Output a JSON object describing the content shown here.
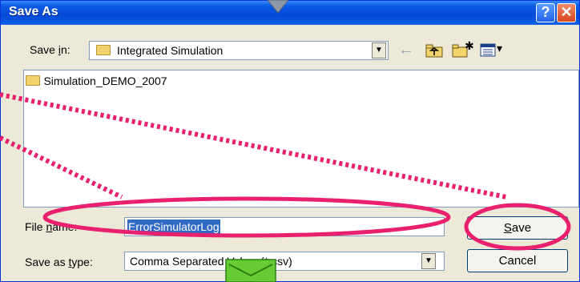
{
  "dialog": {
    "title": "Save As",
    "help_glyph": "?",
    "close_glyph": "✕"
  },
  "save_in": {
    "label_pre": "Save ",
    "label_u": "i",
    "label_post": "n:",
    "value": "Integrated Simulation"
  },
  "toolbar": {
    "back_glyph": "←",
    "new_folder_glyph": "✱",
    "view_caret": "▾"
  },
  "files": [
    {
      "name": "Simulation_DEMO_2007",
      "icon": "folder-icon"
    }
  ],
  "file_name": {
    "label_pre": "File ",
    "label_u": "n",
    "label_post": "ame:",
    "value": "ErrorSimulatorLog"
  },
  "save_type": {
    "label_pre": "Save as ",
    "label_u": "t",
    "label_post": "ype:",
    "value": "Comma Separated Values(*.csv)"
  },
  "buttons": {
    "save_u": "S",
    "save_rest": "ave",
    "cancel": "Cancel"
  },
  "annotation": {
    "highlight_color": "#e8206e",
    "arrow_color": "#66cc33"
  }
}
